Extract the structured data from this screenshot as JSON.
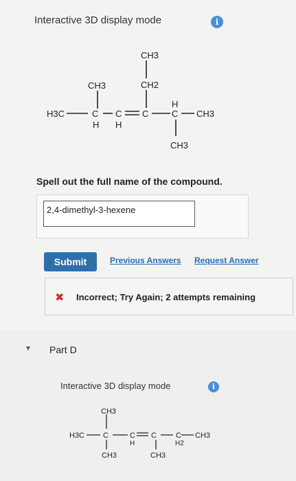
{
  "mode_label": "Interactive 3D display mode",
  "info_icon": "i",
  "structure1": {
    "top_ch3": "CH3",
    "mid_ch2": "CH2",
    "left_ch3": "CH3",
    "h3c": "H3C",
    "c1": "C",
    "c2": "C",
    "c3": "C",
    "c4": "C",
    "h_under1": "H",
    "h_under2": "H",
    "h_over": "H",
    "right_ch3": "CH3",
    "bottom_ch3": "CH3"
  },
  "question": "Spell out the full name of the compound.",
  "answer_value": "2,4-dimethyl-3-hexene",
  "submit_label": "Submit",
  "previous_answers_label": "Previous Answers",
  "request_answer_label": "Request Answer",
  "feedback_text": "Incorrect; Try Again; 2 attempts remaining",
  "part_label": "Part D",
  "part_d": {
    "mode_label": "Interactive 3D display mode",
    "structure": {
      "top_ch3": "CH3",
      "h3c": "H3C",
      "c1": "C",
      "c2": "C",
      "c3": "C",
      "c4": "C",
      "h2": "H2",
      "right_ch3": "CH3",
      "bottom_ch3_left": "CH3",
      "bottom_ch3_right": "CH3",
      "h_c2": "H"
    }
  },
  "colors": {
    "link": "#2a6db0",
    "submit_bg": "#2f6fa9",
    "error": "#d12a2a",
    "info": "#4a8fd6"
  }
}
